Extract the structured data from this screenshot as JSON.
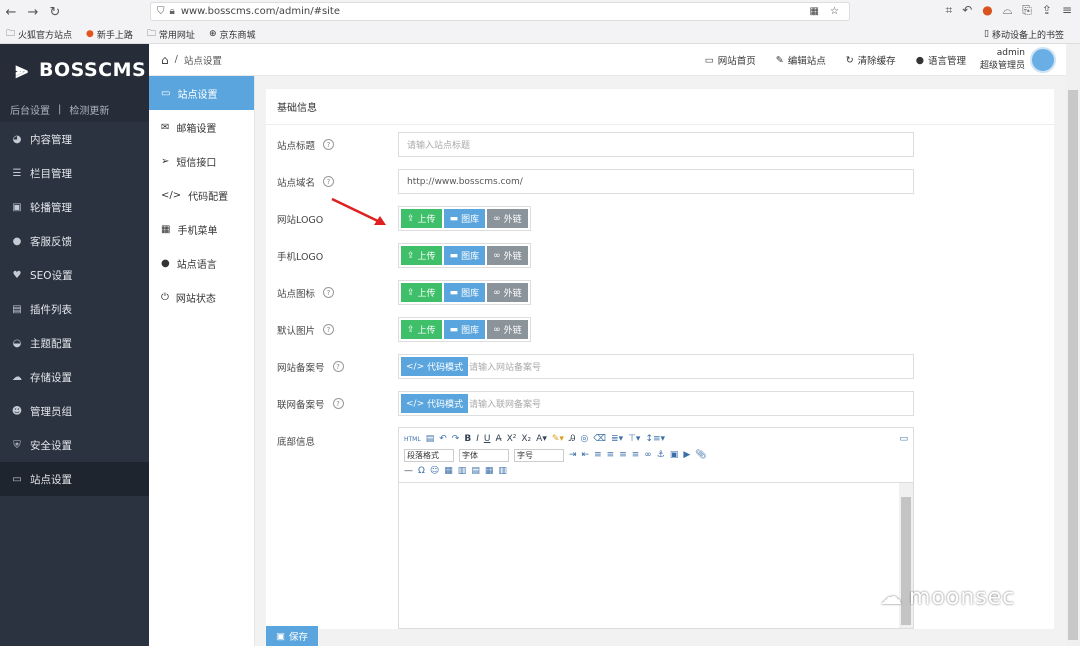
{
  "browser": {
    "url": "www.bosscms.com/admin/#site",
    "bookmarks": [
      "火狐官方站点",
      "新手上路",
      "常用网址",
      "京东商城"
    ],
    "mobile_bookmarks": "移动设备上的书签"
  },
  "sidebar": {
    "logo": "BOSSCMS",
    "sub_left": "后台设置",
    "sub_sep": "|",
    "sub_right": "检测更新",
    "items": [
      {
        "label": "内容管理",
        "icon": "pie-icon"
      },
      {
        "label": "栏目管理",
        "icon": "list-icon"
      },
      {
        "label": "轮播管理",
        "icon": "image-icon"
      },
      {
        "label": "客服反馈",
        "icon": "comment-icon"
      },
      {
        "label": "SEO设置",
        "icon": "heart-icon"
      },
      {
        "label": "插件列表",
        "icon": "clipboard-icon"
      },
      {
        "label": "主题配置",
        "icon": "dashboard-icon"
      },
      {
        "label": "存储设置",
        "icon": "cloud-icon"
      },
      {
        "label": "管理员组",
        "icon": "users-icon"
      },
      {
        "label": "安全设置",
        "icon": "shield-icon"
      },
      {
        "label": "站点设置",
        "icon": "window-icon"
      }
    ]
  },
  "submenu": {
    "items": [
      {
        "label": "站点设置",
        "icon": "window-icon"
      },
      {
        "label": "邮箱设置",
        "icon": "mail-icon"
      },
      {
        "label": "短信接口",
        "icon": "send-icon"
      },
      {
        "label": "代码配置",
        "icon": "code-icon"
      },
      {
        "label": "手机菜单",
        "icon": "calendar-icon"
      },
      {
        "label": "站点语言",
        "icon": "globe-icon"
      },
      {
        "label": "网站状态",
        "icon": "power-icon"
      }
    ]
  },
  "topbar": {
    "breadcrumb_sep": "/",
    "breadcrumb": "站点设置",
    "links": [
      "网站首页",
      "编辑站点",
      "清除缓存",
      "语言管理"
    ],
    "user_name": "admin",
    "user_role": "超级管理员"
  },
  "form": {
    "section_title": "基础信息",
    "site_title_label": "站点标题",
    "site_title_placeholder": "请输入站点标题",
    "domain_label": "站点域名",
    "domain_value": "http://www.bosscms.com/",
    "site_logo_label": "网站LOGO",
    "mobile_logo_label": "手机LOGO",
    "site_icon_label": "站点图标",
    "default_image_label": "默认图片",
    "upload": "上传",
    "library": "图库",
    "external": "外链",
    "icp_label": "网站备案号",
    "icp_placeholder": "请输入网站备案号",
    "police_label": "联网备案号",
    "police_placeholder": "请输入联网备案号",
    "code_mode": "代码模式",
    "footer_label": "底部信息",
    "editor": {
      "paragraph": "段落格式",
      "font": "字体",
      "size": "字号"
    },
    "save": "保存"
  },
  "watermark": "moonsec"
}
